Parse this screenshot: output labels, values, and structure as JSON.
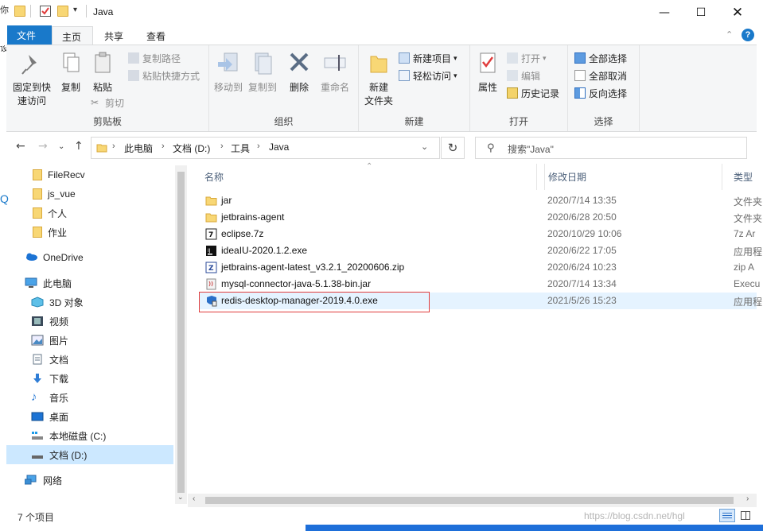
{
  "window": {
    "title": "Java",
    "cut_chars": {
      "top_left": "你",
      "left": "设"
    }
  },
  "ribbon_tabs": [
    {
      "label": "文件"
    },
    {
      "label": "主页"
    },
    {
      "label": "共享"
    },
    {
      "label": "查看"
    }
  ],
  "ribbon": {
    "clipboard": {
      "label": "剪贴板",
      "pin": "固定到快\n速访问",
      "pin_l1": "固定到快",
      "pin_l2": "速访问",
      "copy": "复制",
      "paste": "粘贴",
      "copy_path": "复制路径",
      "paste_shortcut": "粘贴快捷方式",
      "cut": "剪切"
    },
    "organize": {
      "label": "组织",
      "move_to": "移动到",
      "copy_to": "复制到",
      "delete": "删除",
      "rename": "重命名"
    },
    "new": {
      "label": "新建",
      "new_folder_l1": "新建",
      "new_folder_l2": "文件夹",
      "new_item": "新建项目",
      "easy_access": "轻松访问"
    },
    "open": {
      "label": "打开",
      "properties": "属性",
      "open": "打开",
      "edit": "编辑",
      "history": "历史记录"
    },
    "select": {
      "label": "选择",
      "select_all": "全部选择",
      "select_none": "全部取消",
      "invert": "反向选择"
    }
  },
  "address": {
    "crumbs": [
      "此电脑",
      "文档 (D:)",
      "工具",
      "Java"
    ],
    "search_placeholder": "搜索\"Java\""
  },
  "nav_pane": {
    "quick_items": [
      "FileRecv",
      "js_vue",
      "个人",
      "作业"
    ],
    "onedrive": "OneDrive",
    "this_pc": "此电脑",
    "pc_items": [
      "3D 对象",
      "视频",
      "图片",
      "文档",
      "下载",
      "音乐",
      "桌面",
      "本地磁盘 (C:)",
      "文档 (D:)"
    ],
    "network": "网络"
  },
  "file_list": {
    "columns": {
      "name": "名称",
      "date": "修改日期",
      "type": "类型"
    },
    "rows": [
      {
        "name": "jar",
        "date": "2020/7/14 13:35",
        "type": "文件夹",
        "icon": "folder-icon"
      },
      {
        "name": "jetbrains-agent",
        "date": "2020/6/28 20:50",
        "type": "文件夹",
        "icon": "folder-icon"
      },
      {
        "name": "eclipse.7z",
        "date": "2020/10/29 10:06",
        "type": "7z Ar",
        "icon": "archive-7z-icon"
      },
      {
        "name": "ideaIU-2020.1.2.exe",
        "date": "2020/6/22 17:05",
        "type": "应用程",
        "icon": "intellij-icon"
      },
      {
        "name": "jetbrains-agent-latest_v3.2.1_20200606.zip",
        "date": "2020/6/24 10:23",
        "type": "zip A",
        "icon": "zip-icon"
      },
      {
        "name": "mysql-connector-java-5.1.38-bin.jar",
        "date": "2020/7/14 13:34",
        "type": "Execu",
        "icon": "jar-icon"
      },
      {
        "name": "redis-desktop-manager-2019.4.0.exe",
        "date": "2021/5/26 15:23",
        "type": "应用程",
        "icon": "redis-installer-icon"
      }
    ]
  },
  "status": {
    "count": "7 个项目"
  },
  "watermark": "https://blog.csdn.net/hgl",
  "colors": {
    "accent": "#1979ca",
    "selection": "#cce8ff",
    "highlight_box": "#e03c3c"
  }
}
